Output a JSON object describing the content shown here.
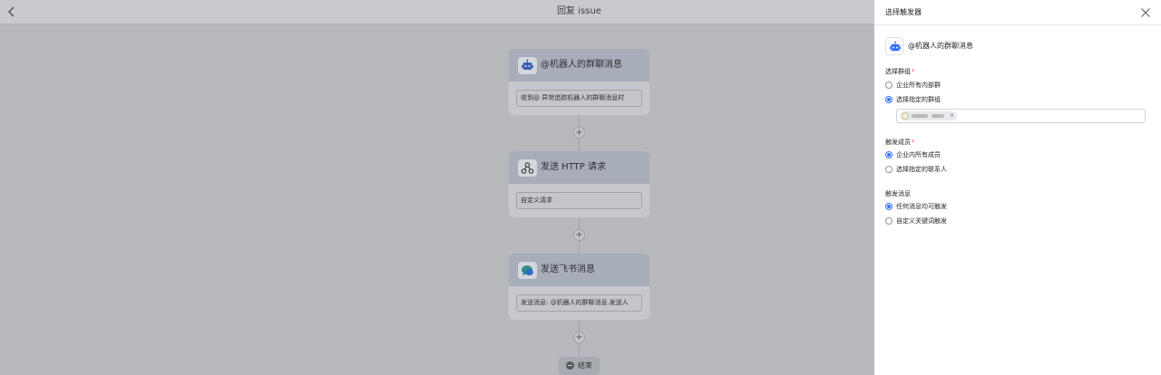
{
  "canvas": {
    "title": "回复 issue",
    "nodes": [
      {
        "icon": "robot-icon",
        "title": "@机器人的群聊消息",
        "body": "收到@ 异常追踪机器人的群聊消息时"
      },
      {
        "icon": "webhook-icon",
        "title": "发送 HTTP 请求",
        "body": "自定义请求"
      },
      {
        "icon": "message-bubble-icon",
        "title": "发送飞书消息",
        "body": "发送消息: @机器人的群聊消息.发送人"
      }
    ],
    "add_symbol": "+",
    "end_label": "结束"
  },
  "panel": {
    "title": "选择触发器",
    "trigger": {
      "icon": "robot-icon",
      "name": "@机器人的群聊消息"
    },
    "group_section": {
      "label": "选择群组",
      "required_mark": "*",
      "options": [
        {
          "label": "企业所有内部群",
          "selected": false
        },
        {
          "label": "选择指定的群组",
          "selected": true
        }
      ]
    },
    "member_section": {
      "label": "触发成员",
      "required_mark": "*",
      "options": [
        {
          "label": "企业内所有成员",
          "selected": true
        },
        {
          "label": "选择指定的联系人",
          "selected": false
        }
      ]
    },
    "message_section": {
      "label": "触发消息",
      "options": [
        {
          "label": "任何消息均可触发",
          "selected": true
        },
        {
          "label": "自定义关键词触发",
          "selected": false
        }
      ]
    },
    "selected_group_chip": {
      "remove_symbol": "×"
    }
  },
  "colors": {
    "accent": "#3370ff",
    "required": "#f54a45",
    "overlay": "#b7b9bd"
  }
}
